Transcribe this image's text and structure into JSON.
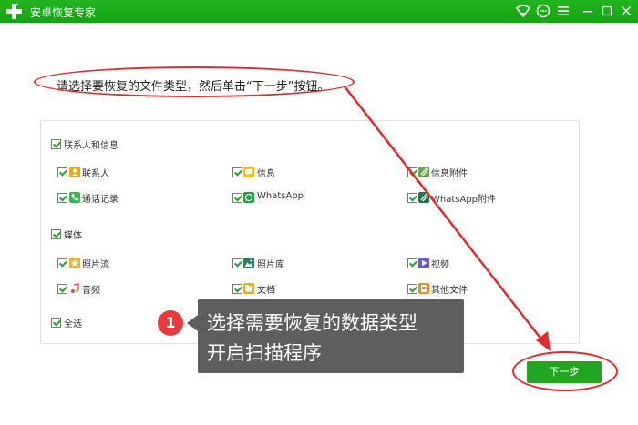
{
  "app": {
    "title": "安卓恢复专家"
  },
  "instruction": "请选择要恢复的文件类型，然后单击“下一步”按钮。",
  "sections": {
    "contacts_info": {
      "label": "联系人和信息",
      "items": [
        {
          "label": "联系人",
          "icon": "contact-icon",
          "color": "#f2a516"
        },
        {
          "label": "信息",
          "icon": "message-icon",
          "color": "#f4c20d"
        },
        {
          "label": "信息附件",
          "icon": "attachment-icon",
          "color": "#6aa84f"
        },
        {
          "label": "通话记录",
          "icon": "call-icon",
          "color": "#34b853"
        },
        {
          "label": "WhatsApp",
          "icon": "whatsapp-icon",
          "color": "#25a244"
        },
        {
          "label": "WhatsApp附件",
          "icon": "whatsapp-attachment-icon",
          "color": "#1f7a4a"
        }
      ]
    },
    "media": {
      "label": "媒体",
      "items": [
        {
          "label": "照片流",
          "icon": "photostream-icon",
          "color": "#f0b030"
        },
        {
          "label": "照片库",
          "icon": "gallery-icon",
          "color": "#2e7d6b"
        },
        {
          "label": "视频",
          "icon": "video-icon",
          "color": "#6a5acd"
        },
        {
          "label": "音频",
          "icon": "audio-icon",
          "color": "#e04848"
        },
        {
          "label": "文档",
          "icon": "document-icon",
          "color": "#f3a920"
        },
        {
          "label": "其他文件",
          "icon": "other-files-icon",
          "color": "#f08a24"
        }
      ]
    },
    "select_all": {
      "label": "全选"
    }
  },
  "callout": {
    "step": "1",
    "line1": "选择需要恢复的数据类型",
    "line2": "开启扫描程序"
  },
  "next_button": {
    "label": "下一步"
  },
  "colors": {
    "brand_green": "#1aad19",
    "annotation_red": "#e6282c",
    "button_green": "#22a622"
  }
}
